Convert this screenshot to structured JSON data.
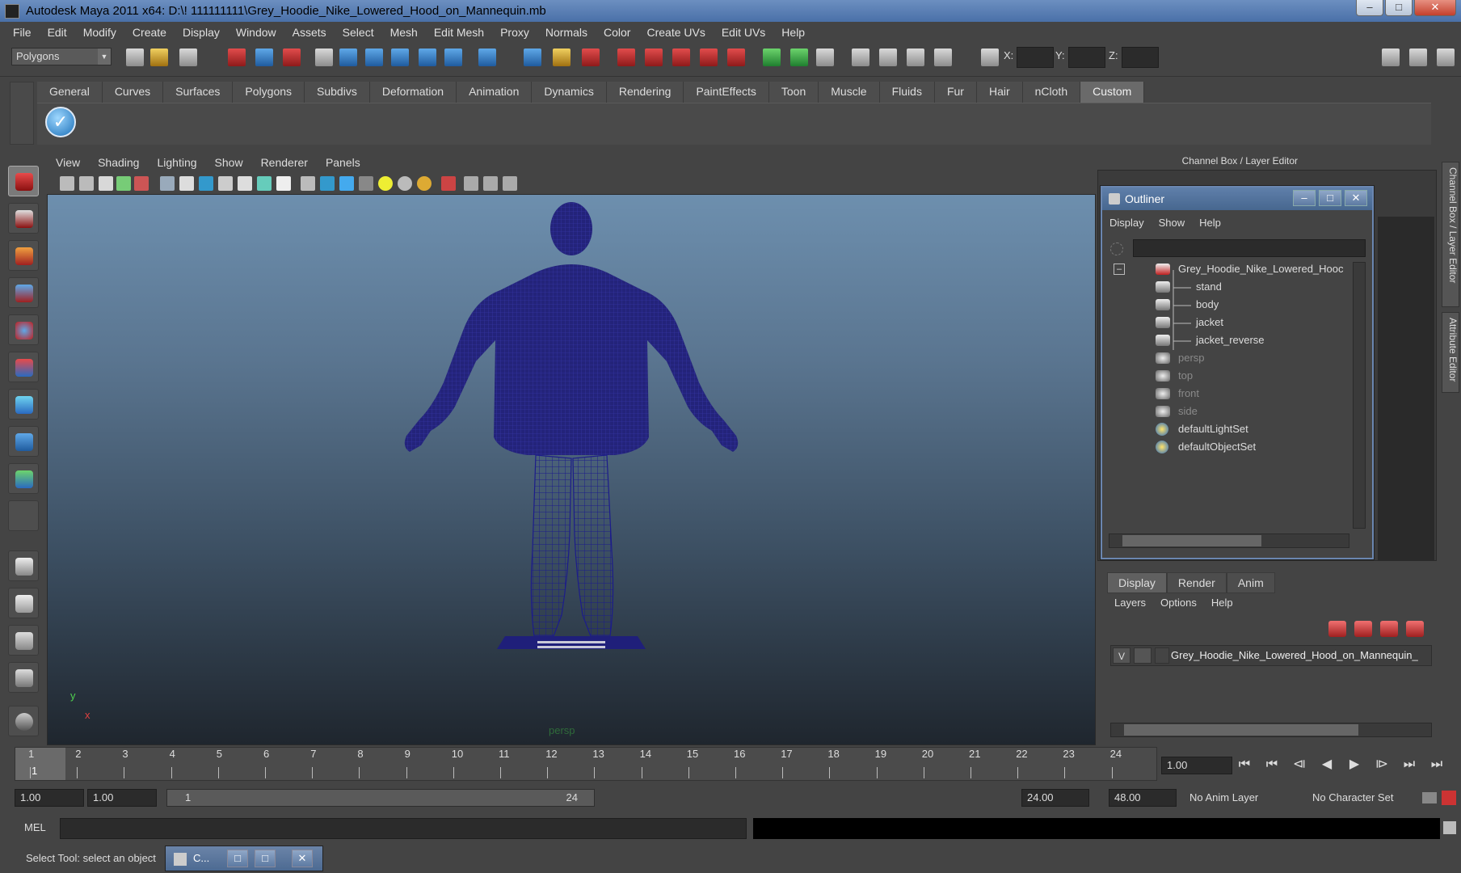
{
  "window": {
    "title": "Autodesk Maya 2011 x64: D:\\! 111111111\\Grey_Hoodie_Nike_Lowered_Hood_on_Mannequin.mb",
    "minimize": "–",
    "maximize": "□",
    "close": "✕"
  },
  "menubar": [
    "File",
    "Edit",
    "Modify",
    "Create",
    "Display",
    "Window",
    "Assets",
    "Select",
    "Mesh",
    "Edit Mesh",
    "Proxy",
    "Normals",
    "Color",
    "Create UVs",
    "Edit UVs",
    "Help"
  ],
  "status": {
    "mode": "Polygons",
    "x_label": "X:",
    "y_label": "Y:",
    "z_label": "Z:"
  },
  "shelf": {
    "tabs": [
      "General",
      "Curves",
      "Surfaces",
      "Polygons",
      "Subdivs",
      "Deformation",
      "Animation",
      "Dynamics",
      "Rendering",
      "PaintEffects",
      "Toon",
      "Muscle",
      "Fluids",
      "Fur",
      "Hair",
      "nCloth",
      "Custom"
    ],
    "active_tab": "Custom",
    "check_icon": "✓"
  },
  "viewport": {
    "menu": [
      "View",
      "Shading",
      "Lighting",
      "Show",
      "Renderer",
      "Panels"
    ],
    "camera_label": "persp",
    "axis_y": "y",
    "axis_x": "x",
    "wire_color": "#1f1f7a"
  },
  "channel_box": {
    "title": "Channel Box / Layer Editor"
  },
  "side_tabs": {
    "channel_box": "Channel Box / Layer Editor",
    "attribute_editor": "Attribute Editor"
  },
  "outliner": {
    "title": "Outliner",
    "menu": [
      "Display",
      "Show",
      "Help"
    ],
    "collapse": "–",
    "items": [
      {
        "name": "Grey_Hoodie_Nike_Lowered_Hooc",
        "icon": "transform-icon",
        "indent": 0,
        "dim": false
      },
      {
        "name": "stand",
        "icon": "mesh-icon",
        "indent": 1,
        "dim": false
      },
      {
        "name": "body",
        "icon": "mesh-icon",
        "indent": 1,
        "dim": false
      },
      {
        "name": "jacket",
        "icon": "mesh-icon",
        "indent": 1,
        "dim": false
      },
      {
        "name": "jacket_reverse",
        "icon": "mesh-icon",
        "indent": 1,
        "dim": false
      },
      {
        "name": "persp",
        "icon": "camera-icon",
        "indent": 0,
        "dim": true
      },
      {
        "name": "top",
        "icon": "camera-icon",
        "indent": 0,
        "dim": true
      },
      {
        "name": "front",
        "icon": "camera-icon",
        "indent": 0,
        "dim": true
      },
      {
        "name": "side",
        "icon": "camera-icon",
        "indent": 0,
        "dim": true
      },
      {
        "name": "defaultLightSet",
        "icon": "set-icon",
        "indent": 0,
        "dim": false
      },
      {
        "name": "defaultObjectSet",
        "icon": "set-icon",
        "indent": 0,
        "dim": false
      }
    ]
  },
  "layer_editor": {
    "tabs": [
      "Display",
      "Render",
      "Anim"
    ],
    "active_tab": "Display",
    "menu": [
      "Layers",
      "Options",
      "Help"
    ],
    "layer": {
      "visible": "V",
      "name": "Grey_Hoodie_Nike_Lowered_Hood_on_Mannequin_"
    }
  },
  "timeline": {
    "ticks": [
      "1",
      "2",
      "3",
      "4",
      "5",
      "6",
      "7",
      "8",
      "9",
      "10",
      "11",
      "12",
      "13",
      "14",
      "15",
      "16",
      "17",
      "18",
      "19",
      "20",
      "21",
      "22",
      "23",
      "24"
    ],
    "current_frame": "1",
    "current_time": "1.00",
    "playback": [
      "⏮",
      "⏮",
      "⧏",
      "◀",
      "▶",
      "⧐",
      "⏭",
      "⏭"
    ]
  },
  "range": {
    "start": "1.00",
    "playback_start": "1.00",
    "slider_start": "1",
    "slider_end": "24",
    "playback_end": "24.00",
    "end": "48.00",
    "anim_layer": "No Anim Layer",
    "character_set": "No Character Set"
  },
  "command": {
    "label": "MEL"
  },
  "help_line": {
    "text": "Select Tool: select an object",
    "mini_window": "C..."
  }
}
